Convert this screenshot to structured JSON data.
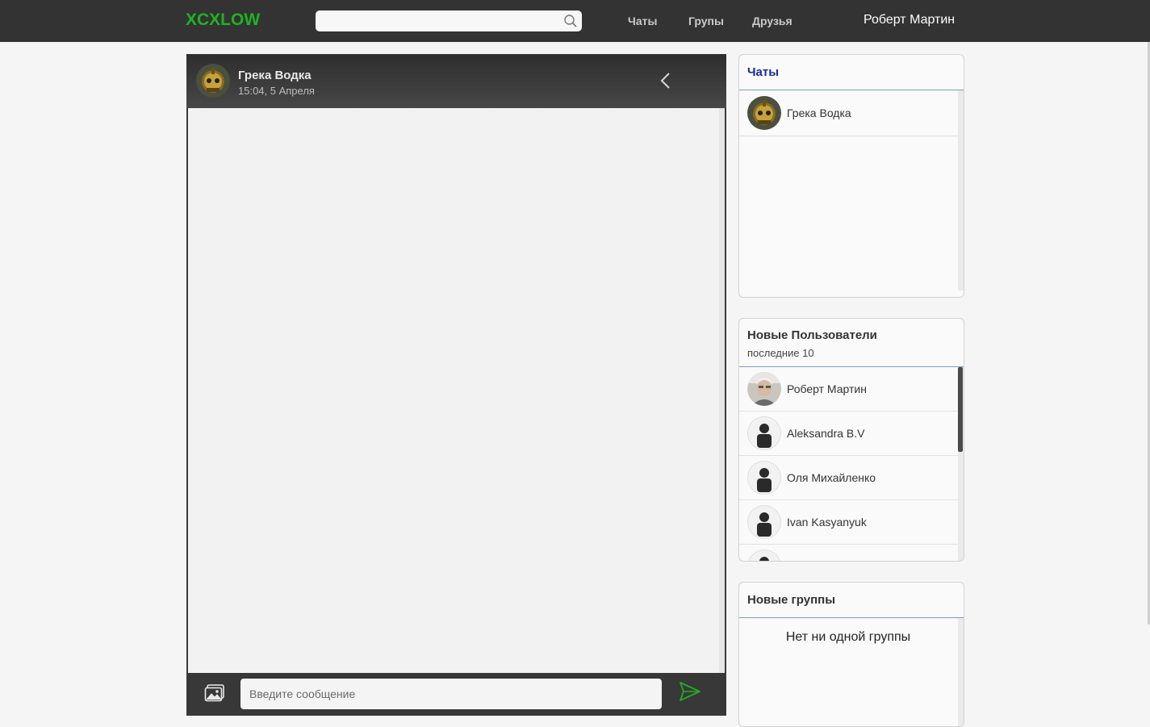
{
  "header": {
    "logo": "XCXLOW",
    "search": {
      "placeholder": "",
      "icon": "search-icon"
    },
    "nav": [
      "Чаты",
      "Групы",
      "Друзья"
    ],
    "user_name": "Роберт Мартин"
  },
  "chat": {
    "title": "Грека Водка",
    "time": "15:04, 5 Апреля",
    "input_placeholder": "Введите сообщение",
    "back_icon": "chevron-left-icon",
    "attach_icon": "image-icon",
    "send_icon": "send-icon"
  },
  "sidebar": {
    "chats": {
      "title": "Чаты",
      "items": [
        {
          "name": "Грека Водка"
        }
      ]
    },
    "new_users": {
      "title": "Новые Пользователи",
      "subtitle": "последние 10",
      "items": [
        {
          "name": "Роберт Мартин"
        },
        {
          "name": "Aleksandra B.V"
        },
        {
          "name": "Оля Михайленко"
        },
        {
          "name": "Ivan Kasyanyuk"
        }
      ]
    },
    "new_groups": {
      "title": "Новые группы",
      "empty_text": "Нет ни одной группы"
    }
  },
  "colors": {
    "brand": "#1fb31f",
    "topbar": "#333333",
    "accent_blue": "#1a2a9c",
    "send": "#22aa22"
  }
}
